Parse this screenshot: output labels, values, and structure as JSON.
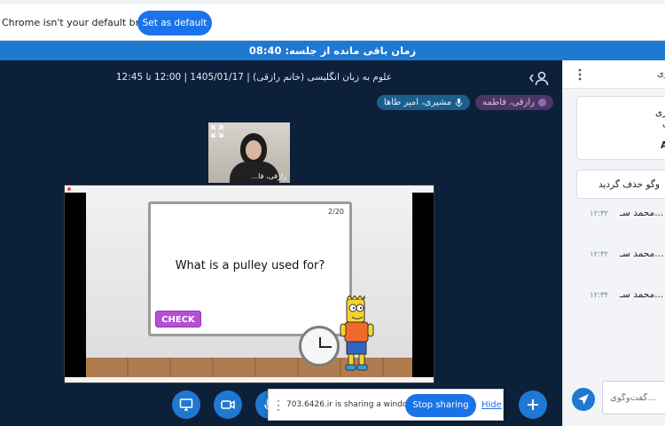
{
  "infobar": {
    "message": "Chrome isn't your default browser",
    "button_label": "Set as default"
  },
  "session_bar": {
    "text": "زمان باقی مانده از جلسه: 08:40"
  },
  "class_header": {
    "title": "علوم به زبان انگلیسی (خانم رازقی) | 1405/01/17 | 12:00 تا 12:45",
    "icon": "person-chevron-icon"
  },
  "participants": [
    {
      "label": "رازقی، فاطمه"
    },
    {
      "label": "مشیری، امیر طاها"
    }
  ],
  "webcam": {
    "name_label": "رازقی، فا..."
  },
  "slide": {
    "page": "2/20",
    "question": "What is a pulley used for?",
    "check_label": "CHECK"
  },
  "controls": [
    {
      "name": "screen-share-icon"
    },
    {
      "name": "camera-icon"
    },
    {
      "name": "microphone-icon"
    },
    {
      "name": "plus-icon"
    }
  ],
  "share_notice": {
    "message": "703.6426.ir is sharing a window.",
    "stop_label": "Stop sharing",
    "hide_label": "Hide"
  },
  "chat_panel": {
    "title": "گفتگوی",
    "pinned": {
      "line1": "ش مجازی",
      "line2": "ری",
      "line3": "A"
    },
    "notice": "وگو حذف گردید",
    "messages": [
      {
        "name": "محمد سـ...",
        "time": "۱۲:۳۲"
      },
      {
        "name": "محمد سـ...",
        "time": "۱۲:۳۲"
      },
      {
        "name": "محمد سـ...",
        "time": "۱۲:۳۴"
      }
    ],
    "input_placeholder": "گفت‌وگوی..."
  },
  "colors": {
    "accent": "#1f78d1",
    "stage_bg": "#0d2039",
    "chrome_blue": "#1a73e8",
    "check_purple": "#b44fd6"
  }
}
